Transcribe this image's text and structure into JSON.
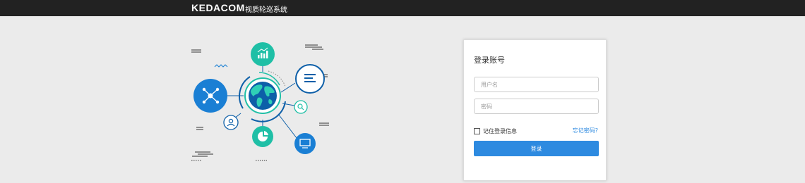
{
  "header": {
    "brand": "KEDACOM",
    "system_name": "视质轮巡系统"
  },
  "illustration": {
    "icons": [
      "globe-icon",
      "bar-chart-icon",
      "document-icon",
      "search-icon",
      "monitor-icon",
      "pie-chart-icon",
      "user-icon",
      "network-icon"
    ]
  },
  "login": {
    "title": "登录账号",
    "username_placeholder": "用户名",
    "username_value": "",
    "password_placeholder": "密码",
    "password_value": "",
    "remember_label": "记住登录信息",
    "remember_checked": false,
    "forgot_label": "忘记密码?",
    "submit_label": "登录"
  },
  "colors": {
    "header_bg": "#222222",
    "page_bg": "#ebebeb",
    "accent": "#2d8ae0",
    "teal": "#1fbfa6",
    "navy": "#0d5fa8",
    "brand_blue": "#1a7fd4"
  }
}
